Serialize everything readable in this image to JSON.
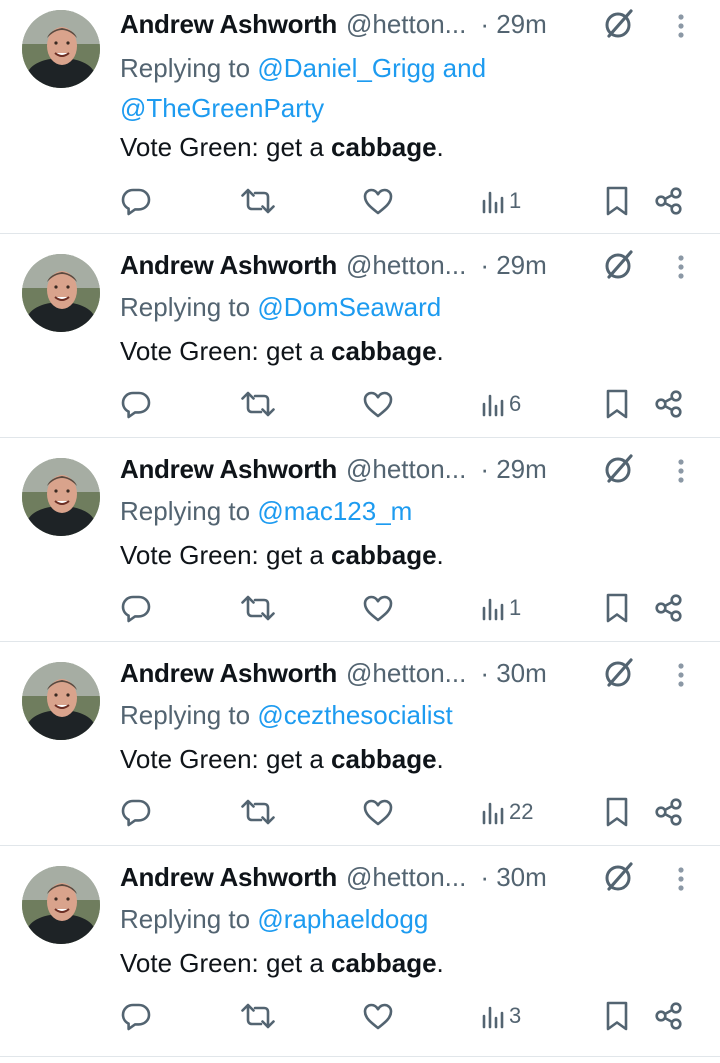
{
  "colors": {
    "link": "#1d9bf0",
    "muted": "#536471",
    "text": "#0f1419",
    "divider": "#e1e6ea"
  },
  "icons": [
    "reply-icon",
    "retweet-icon",
    "like-icon",
    "views-icon",
    "bookmark-icon",
    "share-icon",
    "grok-icon",
    "more-icon"
  ],
  "tweets": [
    {
      "name": "Andrew Ashworth",
      "handle": "@hetton...",
      "time": "· 29m",
      "replying_prefix": "Replying to ",
      "mentions": "@Daniel_Grigg and @TheGreenParty",
      "text_plain": "Vote Green: get a ",
      "text_bold": "cabbage",
      "text_end": ".",
      "views": "1"
    },
    {
      "name": "Andrew Ashworth",
      "handle": "@hetton...",
      "time": "· 29m",
      "replying_prefix": "Replying to ",
      "mentions": "@DomSeaward",
      "text_plain": "Vote Green: get a ",
      "text_bold": "cabbage",
      "text_end": ".",
      "views": "6"
    },
    {
      "name": "Andrew Ashworth",
      "handle": "@hetton...",
      "time": "· 29m",
      "replying_prefix": "Replying to ",
      "mentions": "@mac123_m",
      "text_plain": "Vote Green: get a ",
      "text_bold": "cabbage",
      "text_end": ".",
      "views": "1"
    },
    {
      "name": "Andrew Ashworth",
      "handle": "@hetton...",
      "time": "· 30m",
      "replying_prefix": "Replying to ",
      "mentions": "@cezthesocialist",
      "text_plain": "Vote Green: get a ",
      "text_bold": "cabbage",
      "text_end": ".",
      "views": "22"
    },
    {
      "name": "Andrew Ashworth",
      "handle": "@hetton...",
      "time": "· 30m",
      "replying_prefix": "Replying to ",
      "mentions": "@raphaeldogg",
      "text_plain": "Vote Green: get a ",
      "text_bold": "cabbage",
      "text_end": ".",
      "views": "3"
    }
  ]
}
